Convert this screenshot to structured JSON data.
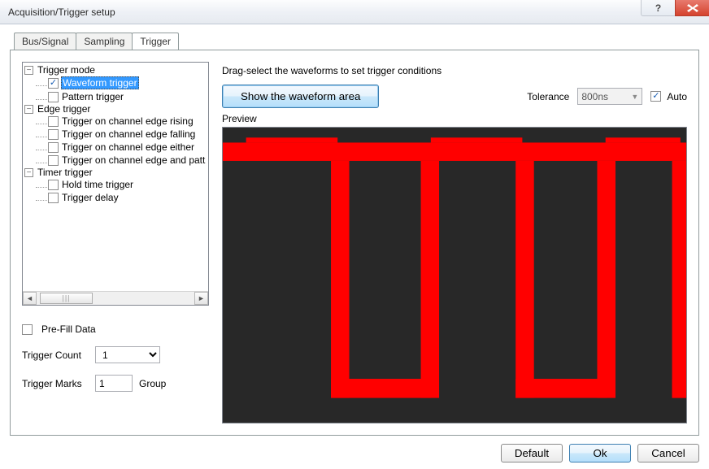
{
  "window": {
    "title": "Acquisition/Trigger setup"
  },
  "tabs": {
    "bus": "Bus/Signal",
    "sampling": "Sampling",
    "trigger": "Trigger"
  },
  "tree": {
    "mode": {
      "label": "Trigger mode",
      "waveform": "Waveform trigger",
      "pattern": "Pattern trigger"
    },
    "edge": {
      "label": "Edge trigger",
      "rising": "Trigger on channel edge rising",
      "falling": "Trigger on channel edge falling",
      "either": "Trigger on channel edge either",
      "patt": "Trigger on channel edge and patt"
    },
    "timer": {
      "label": "Timer trigger",
      "hold": "Hold time trigger",
      "delay": "Trigger delay"
    }
  },
  "options": {
    "prefill": "Pre-Fill Data",
    "trigger_count_label": "Trigger Count",
    "trigger_count_value": "1",
    "trigger_marks_label": "Trigger Marks",
    "trigger_marks_value": "1",
    "group_label": "Group"
  },
  "right": {
    "instruction": "Drag-select the waveforms to set trigger conditions",
    "show_btn": "Show the waveform area",
    "tolerance_label": "Tolerance",
    "tolerance_value": "800ns",
    "auto_label": "Auto",
    "preview_label": "Preview"
  },
  "footer": {
    "default": "Default",
    "ok": "Ok",
    "cancel": "Cancel"
  },
  "colors": {
    "wave": "#ff0000",
    "preview_bg": "#282828"
  }
}
